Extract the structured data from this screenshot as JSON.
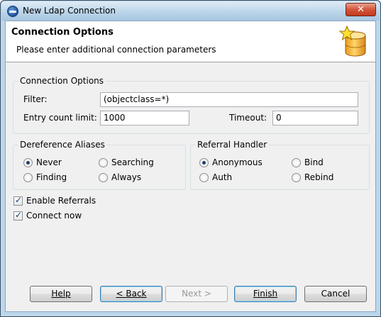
{
  "window": {
    "title": "New Ldap Connection",
    "close_label": "✕"
  },
  "banner": {
    "title": "Connection Options",
    "subtitle": "Please enter additional connection parameters"
  },
  "connection_options": {
    "group_label": "Connection Options",
    "filter_label": "Filter:",
    "filter_value": "(objectclass=*)",
    "entry_count_label": "Entry count limit:",
    "entry_count_value": "1000",
    "timeout_label": "Timeout:",
    "timeout_value": "0"
  },
  "dereference_aliases": {
    "group_label": "Dereference Aliases",
    "options": [
      {
        "label": "Never",
        "checked": true
      },
      {
        "label": "Searching",
        "checked": false
      },
      {
        "label": "Finding",
        "checked": false
      },
      {
        "label": "Always",
        "checked": false
      }
    ]
  },
  "referral_handler": {
    "group_label": "Referral Handler",
    "options": [
      {
        "label": "Anonymous",
        "checked": true
      },
      {
        "label": "Bind",
        "checked": false
      },
      {
        "label": "Auth",
        "checked": false
      },
      {
        "label": "Rebind",
        "checked": false
      }
    ]
  },
  "checkboxes": {
    "enable_referrals": {
      "label": "Enable Referrals",
      "checked": true
    },
    "connect_now": {
      "label": "Connect now",
      "checked": true
    }
  },
  "buttons": {
    "help": "Help",
    "back": "< Back",
    "next": "Next >",
    "finish": "Finish",
    "cancel": "Cancel"
  }
}
